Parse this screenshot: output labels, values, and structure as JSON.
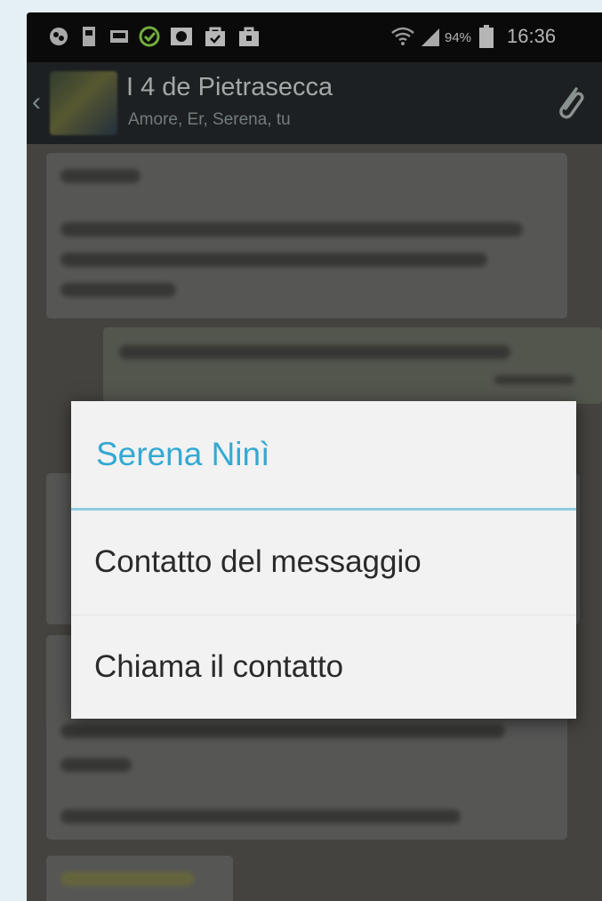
{
  "status_bar": {
    "battery_percent": "94%",
    "time": "16:36",
    "icons": [
      "app-icon",
      "sim-icon",
      "image-icon",
      "check-circle-icon",
      "photo-icon",
      "shopping-bag-icon",
      "briefcase-icon",
      "wifi-icon",
      "signal-icon",
      "battery-icon"
    ]
  },
  "app_bar": {
    "group_name": "I 4 de Pietrasecca",
    "members": "Amore, Er, Serena, tu",
    "icons": [
      "back-icon",
      "group-avatar",
      "paperclip-icon"
    ]
  },
  "dialog": {
    "title": "Serena Ninì",
    "options": [
      "Contatto del messaggio",
      "Chiama il contatto"
    ]
  },
  "colors": {
    "dialog_title": "#34a9d2",
    "dialog_rule": "#8fcde3",
    "app_bar": "#24282a"
  }
}
